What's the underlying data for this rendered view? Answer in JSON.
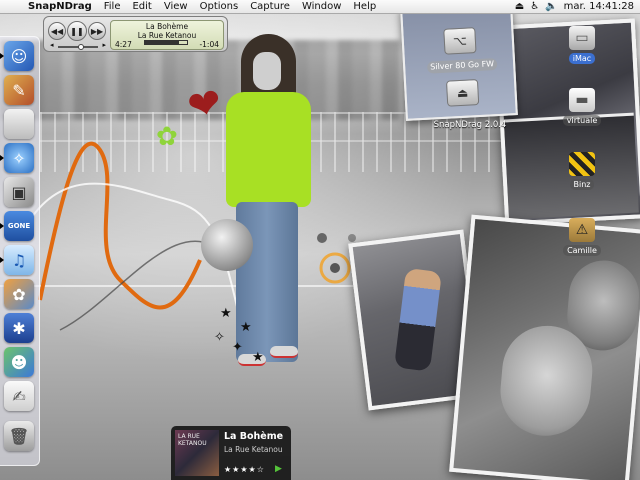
{
  "menubar": {
    "apple_icon": "apple-logo-icon",
    "app_name": "SnapNDrag",
    "menus": [
      "File",
      "Edit",
      "View",
      "Options",
      "Capture",
      "Window",
      "Help"
    ],
    "clock": "mar. 14:41:28",
    "status_icons": [
      "network-icon",
      "accessibility-icon",
      "volume-icon"
    ]
  },
  "itunes": {
    "song": "La Bohème",
    "artist": "La Rue Ketanou",
    "elapsed": "4:27",
    "remaining": "-1:04",
    "progress": 0.81,
    "volume": 0.6,
    "buttons": [
      "rewind-icon",
      "pause-icon",
      "fast-forward-icon"
    ]
  },
  "finder_window": {
    "title": "SnapNDrag 2.0.4",
    "drive_label": "Silver 80 Go FW"
  },
  "desktop_icons": [
    {
      "label": "iMac",
      "icon": "hard-drive-icon"
    },
    {
      "label": "virtuale",
      "icon": "disk-icon"
    },
    {
      "label": "Binz",
      "icon": "caution-sign-icon"
    },
    {
      "label": "Camille",
      "icon": "folder-icon"
    }
  ],
  "dock": {
    "items": [
      "finder-icon",
      "painting-icon",
      "apple-icon",
      "safari-icon",
      "photo-stack-icon",
      "gone-app-icon",
      "itunes-icon",
      "iphoto-icon",
      "imovie-icon",
      "messenger-icon",
      "textedit-icon",
      "trash-icon"
    ],
    "gone_label": "GONE"
  },
  "now_playing": {
    "title": "La Bohème",
    "artist": "La Rue Ketanou",
    "art_text": "LA RUE KETANOU",
    "rating_stars": "★★★★☆",
    "rating": 4,
    "play_icon": "play-icon"
  },
  "colors": {
    "menubar": "#ececec",
    "shirt": "#a8e024",
    "heart": "#9c1d1d",
    "curve_orange": "#e06a10",
    "play_green": "#55c43a"
  }
}
